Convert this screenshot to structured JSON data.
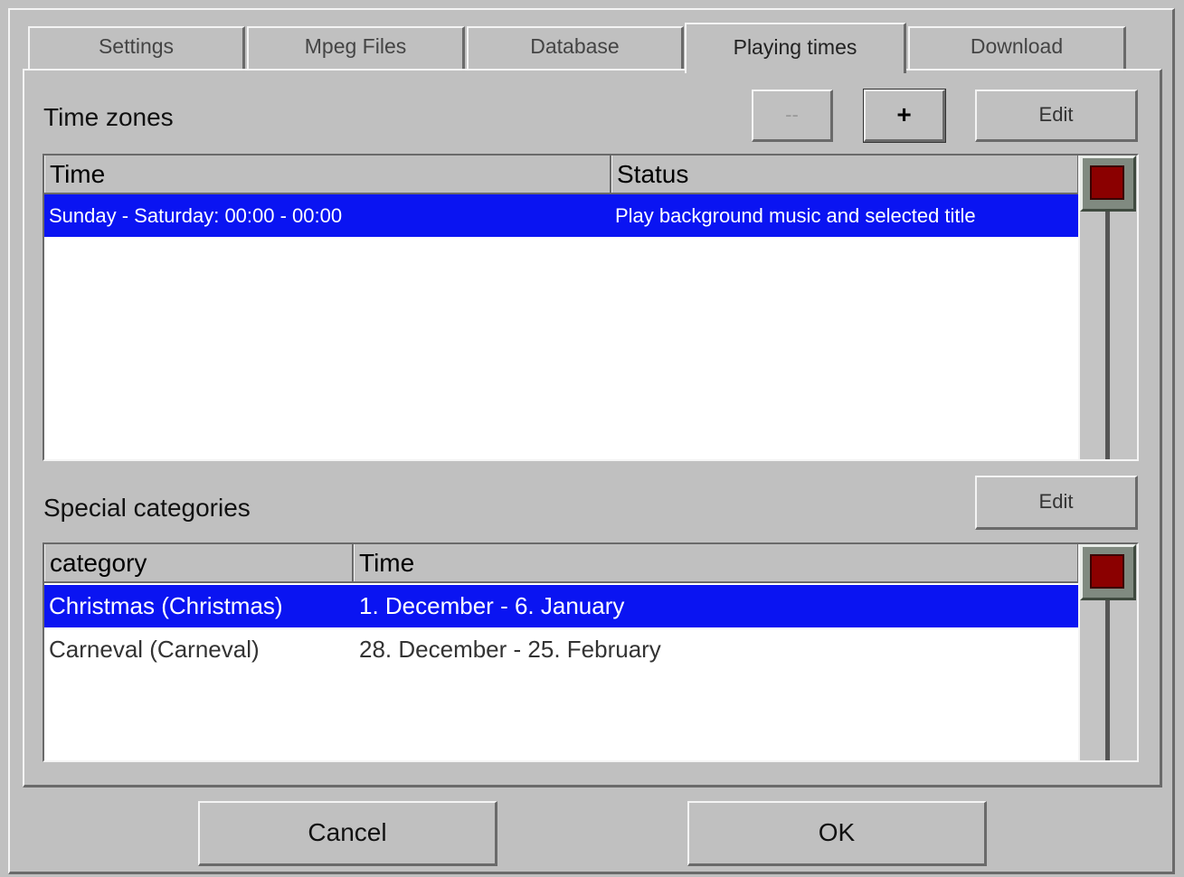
{
  "tabs": [
    {
      "label": "Settings",
      "active": false
    },
    {
      "label": "Mpeg Files",
      "active": false
    },
    {
      "label": "Database",
      "active": false
    },
    {
      "label": "Playing times",
      "active": true
    },
    {
      "label": "Download",
      "active": false
    }
  ],
  "time_zones": {
    "title": "Time zones",
    "minus_label": "--",
    "plus_label": "+",
    "edit_label": "Edit",
    "columns": [
      "Time",
      "Status"
    ],
    "rows": [
      {
        "time": "Sunday - Saturday: 00:00 - 00:00",
        "status": "Play background music and selected title",
        "selected": true
      }
    ]
  },
  "special_categories": {
    "title": "Special categories",
    "edit_label": "Edit",
    "columns": [
      "category",
      "Time"
    ],
    "rows": [
      {
        "category": "Christmas (Christmas)",
        "time": "1. December - 6. January",
        "selected": true
      },
      {
        "category": "Carneval (Carneval)",
        "time": "28. December - 25. February",
        "selected": false
      }
    ]
  },
  "footer": {
    "cancel_label": "Cancel",
    "ok_label": "OK"
  },
  "colors": {
    "selection": "#0a14f2",
    "background": "#c0c0c0",
    "scroll_thumb_accent": "#8b0000"
  }
}
